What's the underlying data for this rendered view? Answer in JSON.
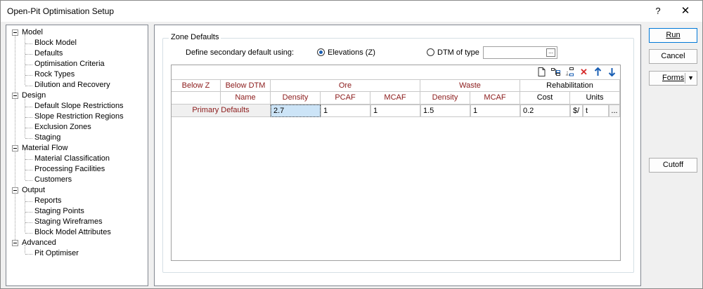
{
  "window": {
    "title": "Open-Pit Optimisation Setup",
    "help": "?",
    "close": "✕"
  },
  "tree": [
    {
      "label": "Model",
      "level": 0
    },
    {
      "label": "Block Model",
      "level": 1
    },
    {
      "label": "Defaults",
      "level": 1
    },
    {
      "label": "Optimisation Criteria",
      "level": 1
    },
    {
      "label": "Rock Types",
      "level": 1
    },
    {
      "label": "Dilution and Recovery",
      "level": 1
    },
    {
      "label": "Design",
      "level": 0
    },
    {
      "label": "Default Slope Restrictions",
      "level": 1
    },
    {
      "label": "Slope Restriction Regions",
      "level": 1
    },
    {
      "label": "Exclusion Zones",
      "level": 1
    },
    {
      "label": "Staging",
      "level": 1
    },
    {
      "label": "Material Flow",
      "level": 0
    },
    {
      "label": "Material Classification",
      "level": 1
    },
    {
      "label": "Processing Facilities",
      "level": 1
    },
    {
      "label": "Customers",
      "level": 1
    },
    {
      "label": "Output",
      "level": 0
    },
    {
      "label": "Reports",
      "level": 1
    },
    {
      "label": "Staging Points",
      "level": 1
    },
    {
      "label": "Staging Wireframes",
      "level": 1
    },
    {
      "label": "Block Model Attributes",
      "level": 1
    },
    {
      "label": "Advanced",
      "level": 0
    },
    {
      "label": "Pit Optimiser",
      "level": 1
    }
  ],
  "zone": {
    "legend": "Zone Defaults",
    "define_label": "Define secondary default using:",
    "opt_elevations": "Elevations (Z)",
    "opt_dtm": "DTM of type",
    "dtm_value": "",
    "dtm_btn": "..."
  },
  "grid": {
    "header1": {
      "below_z": "Below Z",
      "below_dtm": "Below DTM",
      "ore": "Ore",
      "waste": "Waste",
      "rehab": "Rehabilitation"
    },
    "header2": {
      "name": "Name",
      "density": "Density",
      "pcaf": "PCAF",
      "mcaf": "MCAF",
      "w_density": "Density",
      "w_mcaf": "MCAF",
      "cost": "Cost",
      "units": "Units"
    },
    "row": {
      "name": "Primary Defaults",
      "density": "2.7",
      "pcaf": "1",
      "mcaf": "1",
      "w_density": "1.5",
      "w_mcaf": "1",
      "cost": "0.2",
      "unit1": "$/",
      "unit2": "t",
      "more": "..."
    }
  },
  "buttons": {
    "run": "Run",
    "cancel": "Cancel",
    "forms": "Forms",
    "cutoff": "Cutoff"
  },
  "colors": {
    "header_text": "#8b1a1a",
    "selected_cell": "#cce4f7",
    "accent": "#0078d7"
  }
}
